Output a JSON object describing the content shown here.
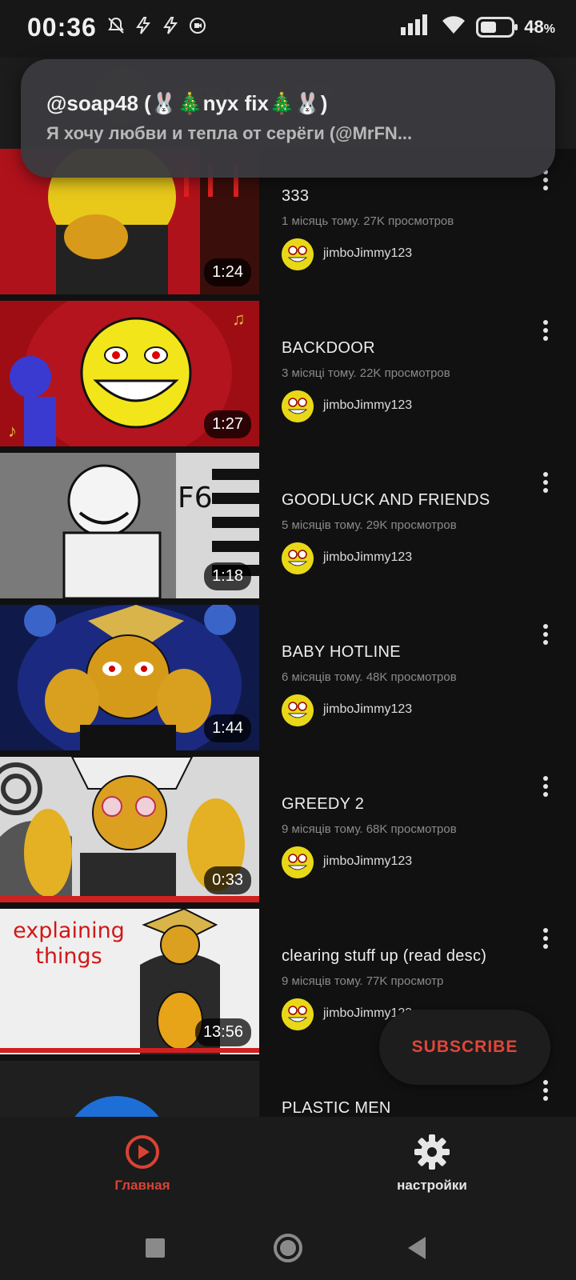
{
  "status_bar": {
    "time": "00:36",
    "battery_percent_label": "48",
    "battery_percent_sign": "%",
    "icons": [
      "dnd-off-icon",
      "flash-icon",
      "flash-icon",
      "screen-record-icon",
      "signal-icon",
      "wifi-icon",
      "battery-icon"
    ]
  },
  "header": {
    "channel_name": "jimboJimmy123"
  },
  "notification": {
    "title": "@soap48 (🐰🎄nyx fix🎄🐰)",
    "body": "Я хочу любви и тепла от серёги (@MrFN..."
  },
  "videos": [
    {
      "title": "333",
      "meta": "1 місяць тому. 27K просмотров",
      "channel": "jimboJimmy123",
      "duration": "1:24"
    },
    {
      "title": "BACKDOOR",
      "meta": "3 місяці тому. 22K просмотров",
      "channel": "jimboJimmy123",
      "duration": "1:27"
    },
    {
      "title": "GOODLUCK AND FRIENDS",
      "meta": "5 місяців тому. 29K просмотров",
      "channel": "jimboJimmy123",
      "duration": "1:18"
    },
    {
      "title": "BABY HOTLINE",
      "meta": "6 місяців тому. 48K просмотров",
      "channel": "jimboJimmy123",
      "duration": "1:44"
    },
    {
      "title": "GREEDY 2",
      "meta": "9 місяців тому. 68K просмотров",
      "channel": "jimboJimmy123",
      "duration": "0:33"
    },
    {
      "title": "clearing stuff up (read desc)",
      "meta": "9 місяців тому. 77K просмотр",
      "channel": "jimboJimmy123",
      "duration": "13:56",
      "thumb_text": "explaining things"
    },
    {
      "title": "PLASTIC MEN",
      "meta": "",
      "channel": "",
      "duration": ""
    }
  ],
  "subscribe_label": "SUBSCRIBE",
  "bottom_nav": {
    "home_label": "Главная",
    "settings_label": "настройки"
  },
  "colors": {
    "accent": "#d84335",
    "background": "#111111",
    "notification_bg": "#3a3a3e"
  }
}
